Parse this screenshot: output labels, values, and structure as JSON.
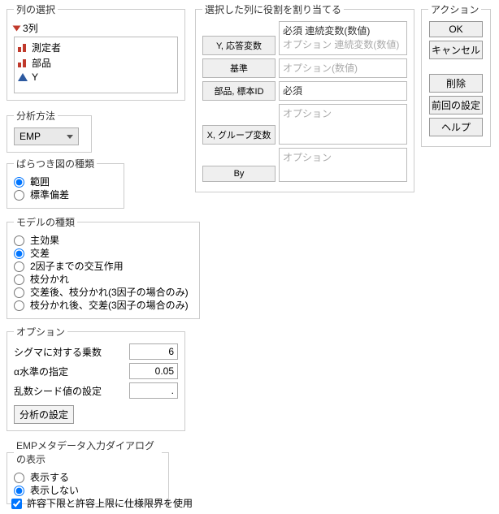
{
  "columns": {
    "legend": "列の選択",
    "count_label": "3列",
    "items": [
      "測定者",
      "部品",
      "Y"
    ]
  },
  "method": {
    "legend": "分析方法",
    "selected": "EMP"
  },
  "scatter": {
    "legend": "ばらつき図の種類",
    "options": [
      "範囲",
      "標準偏差"
    ],
    "selected_index": 0
  },
  "model": {
    "legend": "モデルの種類",
    "options": [
      "主効果",
      "交差",
      "2因子までの交互作用",
      "枝分かれ",
      "交差後、枝分かれ(3因子の場合のみ)",
      "枝分かれ後、交差(3因子の場合のみ)"
    ],
    "selected_index": 1
  },
  "options": {
    "legend": "オプション",
    "sigma_label": "シグマに対する乗数",
    "sigma_value": "6",
    "alpha_label": "α水準の指定",
    "alpha_value": "0.05",
    "seed_label": "乱数シード値の設定",
    "seed_value": ".",
    "settings_btn": "分析の設定"
  },
  "emp_dialog": {
    "legend": "EMPメタデータ入力ダイアログの表示",
    "options": [
      "表示する",
      "表示しない"
    ],
    "selected_index": 1
  },
  "tolerance_check": {
    "label": "許容下限と許容上限に仕様限界を使用",
    "checked": true
  },
  "roles": {
    "legend": "選択した列に役割を割り当てる",
    "y_btn": "Y, 応答変数",
    "y_req": "必須 連続変数(数値)",
    "y_opt": "オプション 連続変数(数値)",
    "std_btn": "基準",
    "std_ph": "オプション(数値)",
    "part_btn": "部品, 標本ID",
    "part_req": "必須",
    "x_btn": "X, グループ変数",
    "x_ph": "オプション",
    "by_btn": "By",
    "by_ph": "オプション"
  },
  "actions": {
    "legend": "アクション",
    "ok": "OK",
    "cancel": "キャンセル",
    "remove": "削除",
    "prev": "前回の設定",
    "help": "ヘルプ"
  }
}
